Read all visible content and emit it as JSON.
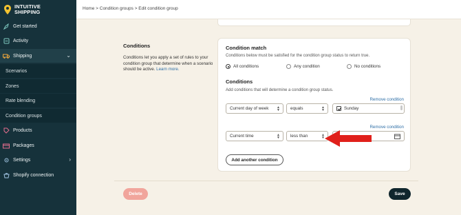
{
  "brand": {
    "line1": "INTUITIVE",
    "line2": "SHIPPING"
  },
  "sidebar": {
    "items": [
      {
        "label": "Get started",
        "icon": "rocket-icon"
      },
      {
        "label": "Activity",
        "icon": "activity-icon"
      },
      {
        "label": "Shipping",
        "icon": "truck-icon"
      },
      {
        "label": "Scenarios"
      },
      {
        "label": "Zones"
      },
      {
        "label": "Rate blending"
      },
      {
        "label": "Condition groups"
      },
      {
        "label": "Products",
        "icon": "tag-icon"
      },
      {
        "label": "Packages",
        "icon": "package-icon"
      },
      {
        "label": "Settings",
        "icon": "gear-icon"
      },
      {
        "label": "Shopify connection",
        "icon": "shopify-icon"
      }
    ]
  },
  "header": {
    "breadcrumb": "Home > Condition groups > Edit condition group"
  },
  "section": {
    "title": "Conditions",
    "description": "Conditions let you apply a set of rules to your condition group that determine when a scenario should be active.",
    "learn_more": "Learn more."
  },
  "condition_match": {
    "title": "Condition match",
    "description": "Conditions below must be satisfied for the condition group status to return true.",
    "options": [
      "All conditions",
      "Any condition",
      "No conditions"
    ],
    "selected": "All conditions"
  },
  "conditions": {
    "title": "Conditions",
    "description": "Add conditions that will determine a condition group status.",
    "remove_label": "Remove condition",
    "rows": [
      {
        "field": "Current day of week",
        "operator": "equals",
        "value": "Sunday"
      },
      {
        "field": "Current time",
        "operator": "less than",
        "value": ""
      }
    ],
    "add_label": "Add another condition"
  },
  "footer": {
    "delete_label": "Delete",
    "save_label": "Save"
  },
  "colors": {
    "sidebar": "#16323b",
    "background": "#f6f1e7",
    "accent_link": "#2d6ea6",
    "delete": "#f1a59c",
    "save": "#10262d",
    "arrow": "#e0201b"
  }
}
